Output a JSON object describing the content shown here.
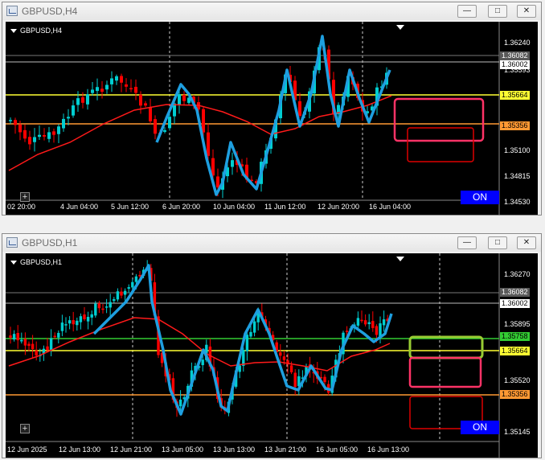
{
  "colors": {
    "background": "#000000",
    "bull_candle": "#00ced1",
    "bear_candle": "#ff0000",
    "ma_line": "#ff1a1a",
    "hand_drawn_line": "#1e9fe0",
    "yellow_level": "#ffff33",
    "orange_level": "#ff9933",
    "green_level": "#33cc33",
    "pink_box": "#ff3366",
    "red_box": "#dd0000",
    "green_box": "#99cc33"
  },
  "window_top": {
    "title": "GBPUSD,H4",
    "chart_label": "GBPUSD,H4",
    "price_axis": [
      "1.36240",
      "1.35593",
      "1.35100",
      "1.34815",
      "1.34530"
    ],
    "price_tags": [
      {
        "text": "1.36082",
        "style": "gray"
      },
      {
        "text": "1.36002",
        "style": "white"
      },
      {
        "text": "1.35664",
        "style": "yellow"
      },
      {
        "text": "1.35356",
        "style": "orange"
      }
    ],
    "time_axis": [
      "02 20:00",
      "4 Jun 04:00",
      "5 Jun 12:00",
      "6 Jun 20:00",
      "10 Jun 04:00",
      "11 Jun 12:00",
      "12 Jun 20:00",
      "16 Jun 04:00"
    ],
    "on_label": "ON",
    "plus_label": "+",
    "buttons": {
      "minimize": "—",
      "maximize": "□",
      "close": "✕"
    }
  },
  "window_bottom": {
    "title": "GBPUSD,H1",
    "chart_label": "GBPUSD,H1",
    "price_axis": [
      "1.36270",
      "1.35895",
      "1.35520",
      "1.35145"
    ],
    "price_tags": [
      {
        "text": "1.36082",
        "style": "gray"
      },
      {
        "text": "1.36002",
        "style": "white"
      },
      {
        "text": "1.35758",
        "style": "green"
      },
      {
        "text": "1.35664",
        "style": "yellow"
      },
      {
        "text": "1.35356",
        "style": "orange"
      }
    ],
    "time_axis": [
      "12 Jun 2025",
      "12 Jun 13:00",
      "12 Jun 21:00",
      "13 Jun 05:00",
      "13 Jun 13:00",
      "13 Jun 21:00",
      "16 Jun 05:00",
      "16 Jun 13:00"
    ],
    "on_label": "ON",
    "plus_label": "+",
    "buttons": {
      "minimize": "—",
      "maximize": "□",
      "close": "✕"
    }
  }
}
